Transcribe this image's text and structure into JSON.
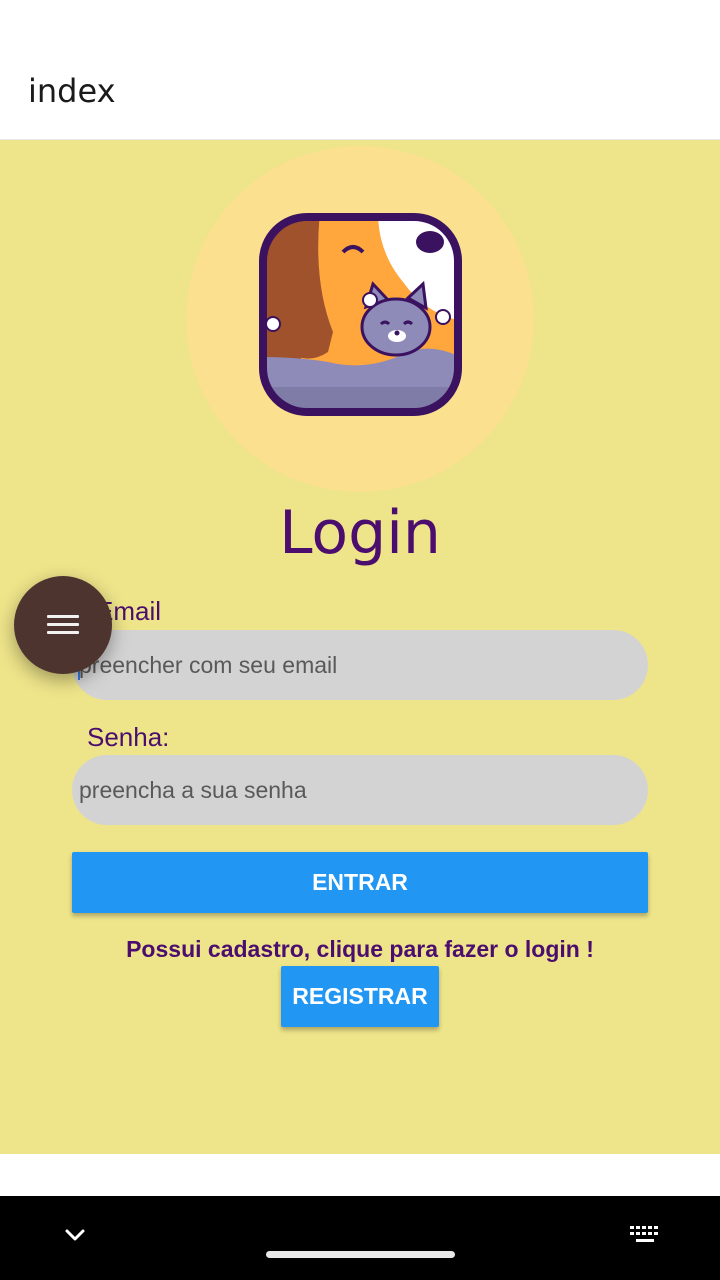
{
  "app_bar": {
    "title": "index"
  },
  "login": {
    "title": "Login",
    "email_label": "Email",
    "email_placeholder": "preencher com seu email",
    "password_label": "Senha:",
    "password_placeholder": "preencha a sua senha",
    "enter_button": "ENTRAR",
    "register_hint": "Possui cadastro, clique para fazer o login !",
    "register_button": "REGISTRAR"
  },
  "fab": {
    "icon": "menu-icon"
  },
  "nav": {
    "left_icon": "chevron-down-icon",
    "right_icon": "keyboard-icon"
  },
  "colors": {
    "background": "#EEE48A",
    "logo_circle": "#FBE08F",
    "title_text": "#4B0E6E",
    "input_bg": "#D3D3D3",
    "button": "#2196F3",
    "fab": "#4E342E"
  }
}
